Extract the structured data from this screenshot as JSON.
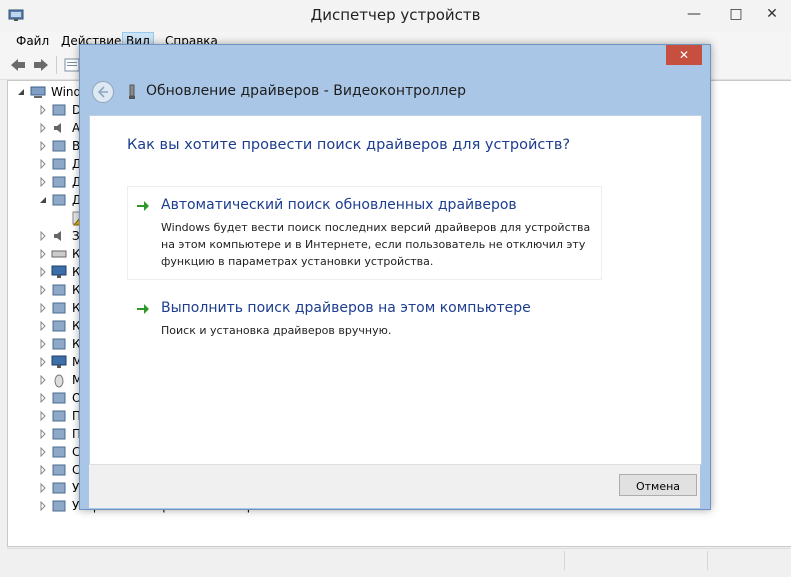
{
  "main_window": {
    "title": "Диспетчер устройств",
    "controls": {
      "minimize": "—",
      "maximize": "□",
      "close": "✕"
    }
  },
  "menu": [
    {
      "label": "Файл"
    },
    {
      "label": "Действие"
    },
    {
      "label": "Вид",
      "active": true
    },
    {
      "label": "Справка"
    }
  ],
  "tree": {
    "root_label": "Windo",
    "items": [
      {
        "label": "DV",
        "icon": "dvd-drive-icon"
      },
      {
        "label": "Ау",
        "icon": "audio-io-icon"
      },
      {
        "label": "Ви",
        "icon": "video-adapter-icon"
      },
      {
        "label": "Ди",
        "icon": "disk-drive-icon"
      },
      {
        "label": "Ди",
        "icon": "disk-drive-icon"
      },
      {
        "label": "Д",
        "icon": "device-manager-folder-icon",
        "expanded": true
      },
      {
        "label": "",
        "icon": "unknown-device-warning-icon",
        "child": true
      },
      {
        "label": "Зв",
        "icon": "speaker-icon"
      },
      {
        "label": "Кл",
        "icon": "keyboard-icon"
      },
      {
        "label": "Ко",
        "icon": "computer-icon"
      },
      {
        "label": "Ко",
        "icon": "usb-controller-icon"
      },
      {
        "label": "Ко",
        "icon": "storage-controller-icon"
      },
      {
        "label": "Ко",
        "icon": "ide-controller-icon"
      },
      {
        "label": "Ко",
        "icon": "usb-plug-icon"
      },
      {
        "label": "М",
        "icon": "monitor-icon"
      },
      {
        "label": "М",
        "icon": "mouse-icon"
      },
      {
        "label": "О",
        "icon": "queue-icon"
      },
      {
        "label": "П",
        "icon": "printer-icon"
      },
      {
        "label": "П",
        "icon": "processor-icon"
      },
      {
        "label": "Се",
        "icon": "network-adapter-icon"
      },
      {
        "label": "Си",
        "icon": "system-device-icon"
      },
      {
        "label": "Ус",
        "icon": "hid-device-icon"
      },
      {
        "label": "Устройства обработки изображений",
        "icon": "imaging-device-icon"
      }
    ]
  },
  "dialog": {
    "title": "Обновление драйверов - Видеоконтроллер",
    "close": "✕",
    "question": "Как вы хотите провести поиск драйверов для устройств?",
    "options": [
      {
        "title": "Автоматический поиск обновленных драйверов",
        "description": "Windows будет вести поиск последних версий драйверов для устройства на этом компьютере и в Интернете, если пользователь не отключил эту функцию в параметрах установки устройства."
      },
      {
        "title": "Выполнить поиск драйверов на этом компьютере",
        "description": "Поиск и установка драйверов вручную."
      }
    ],
    "cancel_label": "Отмена"
  },
  "colors": {
    "dialog_frame": "#a9c6e6",
    "link_blue": "#1d3d8f",
    "arrow_green": "#2b9a2b",
    "close_red": "#c74f3f"
  }
}
